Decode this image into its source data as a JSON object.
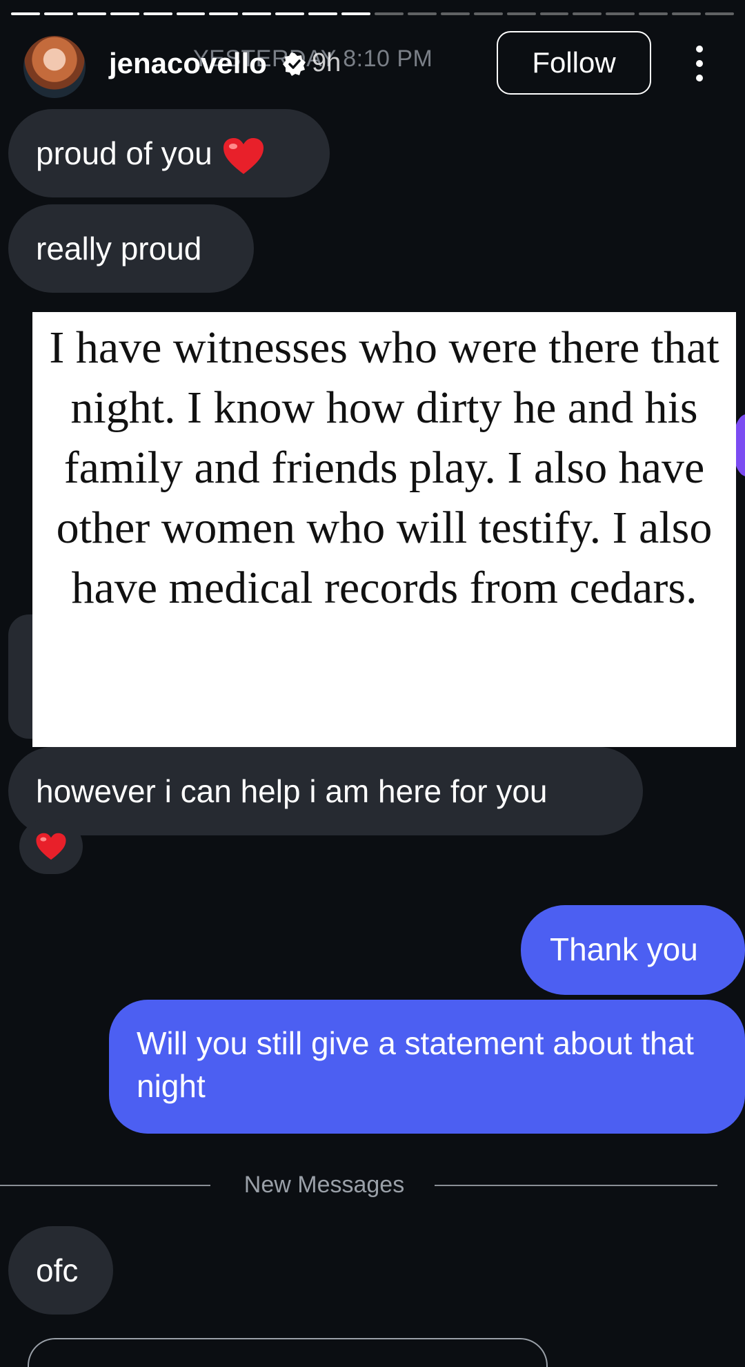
{
  "story": {
    "segments_total": 22,
    "segments_viewed": 11
  },
  "header": {
    "username": "jenacovello",
    "time_ago": "9h",
    "date_stamp": "YESTERDAY 8:10 PM",
    "follow_label": "Follow"
  },
  "messages": {
    "m1": "proud of you",
    "m2": "really proud",
    "card_text": "I have witnesses who were there that night. I know how dirty he and his family and friends play. I also have other women who will testify. I also have medical records from cedars.",
    "m3": "however i can help i am here for you",
    "m4": "Thank you",
    "m5": "Will you still give a statement about that night",
    "new_messages_label": "New Messages",
    "m6": "ofc"
  },
  "colors": {
    "incoming_bubble": "#262a31",
    "outgoing_bubble": "#4c5ff2",
    "background": "#0b0e12"
  },
  "icons": [
    "verified-badge-icon",
    "more-options-icon",
    "red-heart-emoji"
  ]
}
